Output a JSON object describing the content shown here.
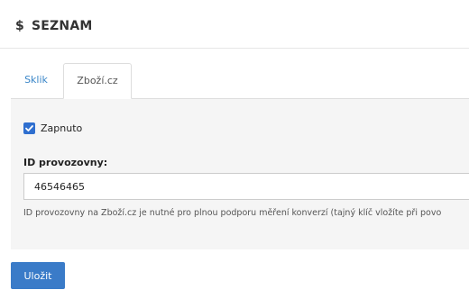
{
  "header": {
    "icon": "dollar-icon",
    "icon_glyph": "$",
    "title": "SEZNAM"
  },
  "tabs": [
    {
      "label": "Sklik",
      "active": false
    },
    {
      "label": "Zboží.cz",
      "active": true
    }
  ],
  "form": {
    "enabled_checked": true,
    "enabled_label": "Zapnuto",
    "field_label": "ID provozovny:",
    "field_value": "46546465",
    "help_text": "ID provozovny na Zboží.cz je nutné pro plnou podporu měření konverzí (tajný klíč vložíte při povo"
  },
  "actions": {
    "save_label": "Uložit"
  },
  "colors": {
    "accent": "#3a7bc8",
    "link": "#3a86c8",
    "panel_background": "#f5f5f5",
    "checkbox": "#2f6fcf"
  }
}
